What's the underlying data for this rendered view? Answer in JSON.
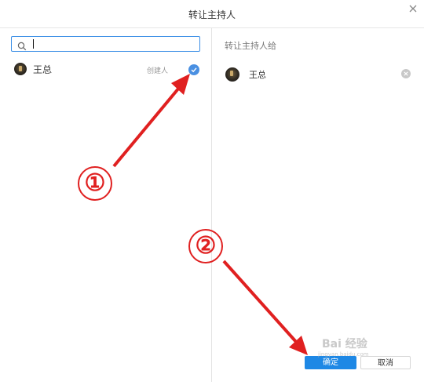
{
  "dialog": {
    "title": "转让主持人",
    "close_icon": "close-icon"
  },
  "left": {
    "search": {
      "value": "",
      "placeholder": "",
      "icon": "search-icon"
    },
    "members": [
      {
        "name": "王总",
        "role": "创建人",
        "selected": true,
        "avatar_icon": "avatar"
      }
    ]
  },
  "right": {
    "header": "转让主持人给",
    "selected": [
      {
        "name": "王总",
        "remove_icon": "remove-icon"
      }
    ]
  },
  "buttons": {
    "confirm": "确定",
    "cancel": "取消"
  },
  "annotations": {
    "step1": "①",
    "step2": "②",
    "arrow_color": "#e02020"
  },
  "watermark": {
    "text": "Bai 经验",
    "sub": "jingyan.baidu.com"
  },
  "colors": {
    "accent": "#1e88e5",
    "check": "#4a90e2"
  }
}
